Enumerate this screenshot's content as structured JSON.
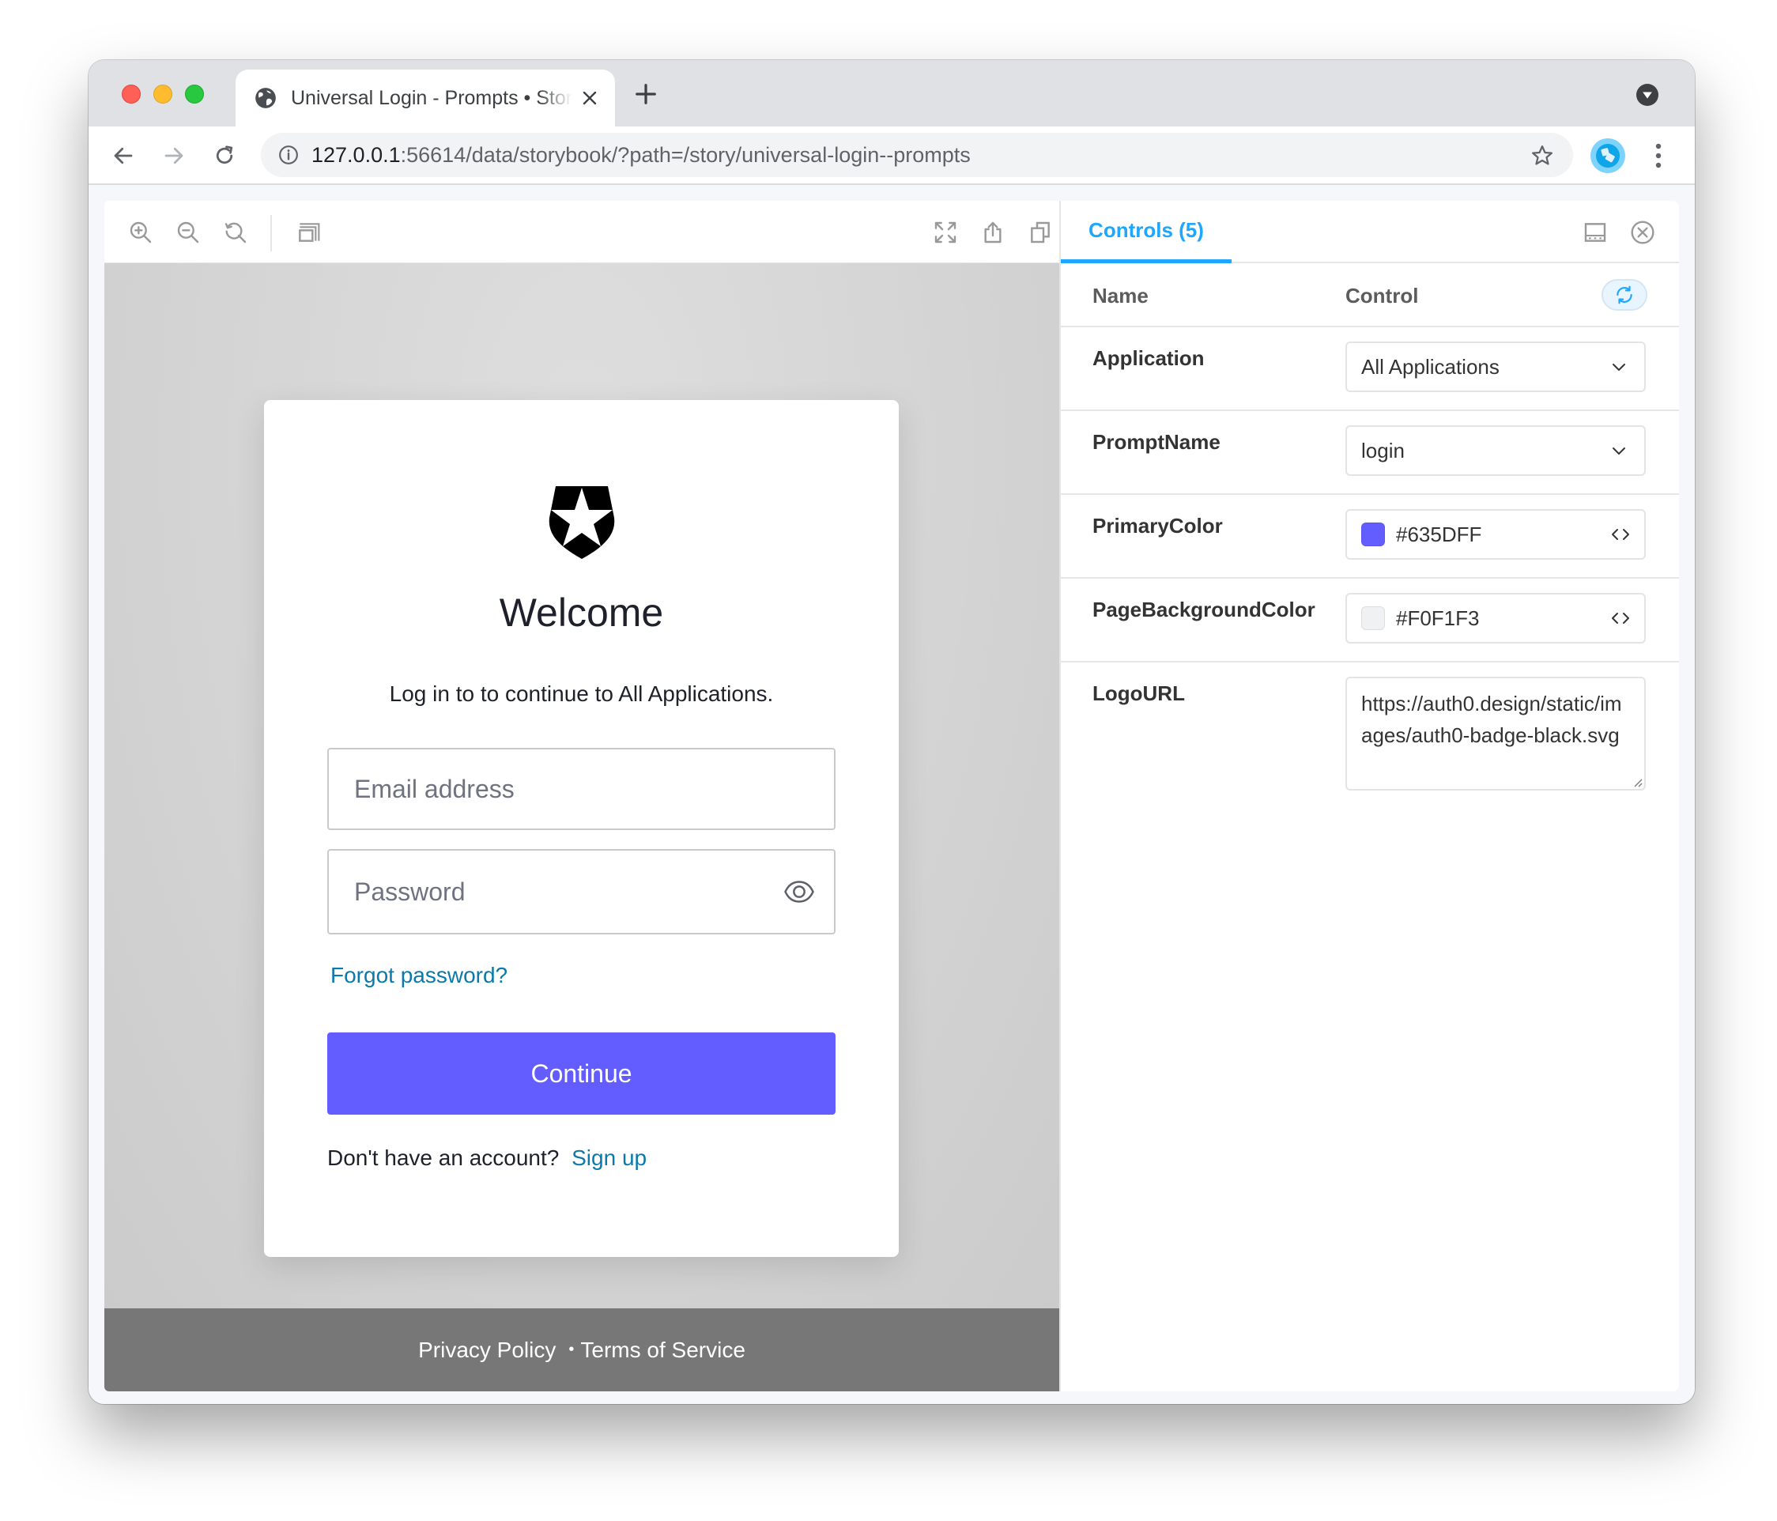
{
  "browser": {
    "tab_title": "Universal Login - Prompts • Storybook",
    "url_host": "127.0.0.1",
    "url_rest": ":56614/data/storybook/?path=/story/universal-login--prompts"
  },
  "login": {
    "title": "Welcome",
    "subtitle": "Log in to to continue to All Applications.",
    "email_placeholder": "Email address",
    "password_placeholder": "Password",
    "forgot_label": "Forgot password?",
    "continue_label": "Continue",
    "signup_prompt": "Don't have an account?",
    "signup_label": "Sign up",
    "primary_color": "#635DFF"
  },
  "footer": {
    "privacy": "Privacy Policy",
    "bullet": "•",
    "terms": "Terms of Service"
  },
  "addons": {
    "tab_label": "Controls (5)",
    "header_name": "Name",
    "header_control": "Control",
    "rows": [
      {
        "name": "Application",
        "type": "select",
        "value": "All Applications"
      },
      {
        "name": "PromptName",
        "type": "select",
        "value": "login"
      },
      {
        "name": "PrimaryColor",
        "type": "color",
        "value": "#635DFF",
        "swatch": "#635DFF"
      },
      {
        "name": "PageBackgroundColor",
        "type": "color",
        "value": "#F0F1F3",
        "swatch": "#F0F1F3"
      },
      {
        "name": "LogoURL",
        "type": "text",
        "value": "https://auth0.design/static/images/auth0-badge-black.svg"
      }
    ]
  },
  "colors": {
    "accent": "#1EA7FD",
    "link": "#0A79AC",
    "footer_bg": "#777777"
  }
}
